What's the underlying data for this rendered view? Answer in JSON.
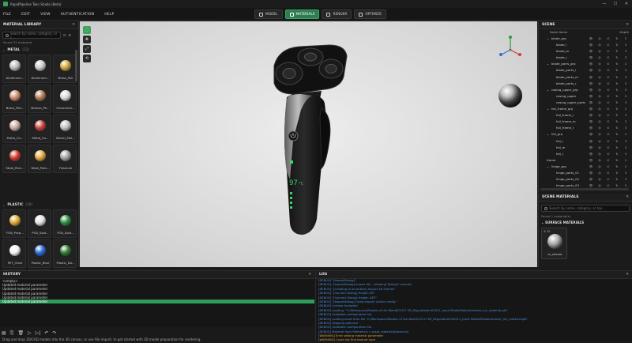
{
  "titlebar": {
    "title": "RapidPipeline Twin Studio (Beta)",
    "min": "—",
    "max": "☐",
    "close": "✕"
  },
  "menu": [
    "FILE",
    "EDIT",
    "VIEW",
    "AUTHENTICATION",
    "HELP"
  ],
  "modes": [
    {
      "label": "MODEL",
      "active": false
    },
    {
      "label": "MATERIALS",
      "active": true
    },
    {
      "label": "RENDER",
      "active": false
    },
    {
      "label": "OPTIMIZE",
      "active": false
    }
  ],
  "material_library": {
    "title": "MATERIAL LIBRARY",
    "search_placeholder": "Search by name, category, or t...",
    "found": "Found 31 materials",
    "categories": [
      {
        "name": "METAL",
        "count": "(12)"
      },
      {
        "name": "PLASTIC",
        "count": "(18)"
      }
    ],
    "metal": [
      {
        "label": "Aluminum...",
        "color": "#b9b9b9"
      },
      {
        "label": "Aluminum...",
        "color": "#c8c8c8"
      },
      {
        "label": "Brass_Poli",
        "color": "#c9a23a"
      },
      {
        "label": "Brass_Poli...",
        "color": "#c98a6a"
      },
      {
        "label": "Bronze_Pe...",
        "color": "#b07a50"
      },
      {
        "label": "Chromium...",
        "color": "#d8d8d8"
      },
      {
        "label": "Metal_Ca...",
        "color": "#c9a9a0"
      },
      {
        "label": "Metal_Ca...",
        "color": "#c8403a"
      },
      {
        "label": "Nickel_Poli...",
        "color": "#bfbfbf"
      },
      {
        "label": "Steel_Pain...",
        "color": "#d23a2a"
      },
      {
        "label": "Steel_Pain...",
        "color": "#e2a43c"
      },
      {
        "label": "Titanium",
        "color": "#a0a0a0"
      }
    ],
    "plastic": [
      {
        "label": "PCB_Prep...",
        "color": "#d8a834"
      },
      {
        "label": "PCB_Sold...",
        "color": "#e0e0e0"
      },
      {
        "label": "PCB_Sold...",
        "color": "#2a8a3a"
      },
      {
        "label": "PET_Clear",
        "color": "#f2f2f2"
      },
      {
        "label": "Plastic_Blue",
        "color": "#2a6ad8"
      },
      {
        "label": "Plastic_Da...",
        "color": "#2f7a2f"
      },
      {
        "label": "",
        "color": "#d84a3a"
      },
      {
        "label": "",
        "color": "#d88a2a"
      },
      {
        "label": "",
        "color": "#bfbfbf"
      }
    ]
  },
  "viewport_tools": [
    "⬚",
    "✥",
    "⤢",
    "⟲"
  ],
  "scene": {
    "title": "SCENE",
    "col_name": "Node Name",
    "col_depth": "Depth",
    "nodes": [
      {
        "name": "blade_grp",
        "indent": 2,
        "depth": "2",
        "chev": "⌄"
      },
      {
        "name": "blade_l",
        "indent": 3,
        "depth": "3",
        "chev": ""
      },
      {
        "name": "blade_m",
        "indent": 3,
        "depth": "3",
        "chev": ""
      },
      {
        "name": "blade_r",
        "indent": 3,
        "depth": "3",
        "chev": ""
      },
      {
        "name": "blade_parts_grp",
        "indent": 2,
        "depth": "2",
        "chev": "⌄"
      },
      {
        "name": "blade_parts_l",
        "indent": 3,
        "depth": "3",
        "chev": ""
      },
      {
        "name": "blade_parts_m",
        "indent": 3,
        "depth": "3",
        "chev": ""
      },
      {
        "name": "blade_parts_r",
        "indent": 3,
        "depth": "3",
        "chev": ""
      },
      {
        "name": "casing_upper_grp",
        "indent": 2,
        "depth": "2",
        "chev": "⌄"
      },
      {
        "name": "casing_upper",
        "indent": 3,
        "depth": "3",
        "chev": ""
      },
      {
        "name": "casing_upper_parts",
        "indent": 3,
        "depth": "3",
        "chev": ""
      },
      {
        "name": "foil_frame_grp",
        "indent": 2,
        "depth": "2",
        "chev": "⌄"
      },
      {
        "name": "foil_frame_l",
        "indent": 3,
        "depth": "3",
        "chev": ""
      },
      {
        "name": "foil_frame_m",
        "indent": 3,
        "depth": "3",
        "chev": ""
      },
      {
        "name": "foil_frame_r",
        "indent": 3,
        "depth": "3",
        "chev": ""
      },
      {
        "name": "foil_grp",
        "indent": 2,
        "depth": "2",
        "chev": "⌄"
      },
      {
        "name": "foil_l",
        "indent": 3,
        "depth": "3",
        "chev": ""
      },
      {
        "name": "foil_m",
        "indent": 3,
        "depth": "3",
        "chev": ""
      },
      {
        "name": "foil_r",
        "indent": 3,
        "depth": "3",
        "chev": ""
      },
      {
        "name": "frame",
        "indent": 1,
        "depth": "1",
        "chev": ""
      },
      {
        "name": "hinge_grp",
        "indent": 2,
        "depth": "2",
        "chev": "⌄"
      },
      {
        "name": "hinge_parts_01",
        "indent": 3,
        "depth": "3",
        "chev": ""
      },
      {
        "name": "hinge_parts_02",
        "indent": 3,
        "depth": "3",
        "chev": ""
      },
      {
        "name": "hinge_parts_03",
        "indent": 3,
        "depth": "3",
        "chev": ""
      }
    ]
  },
  "scene_materials": {
    "title": "SCENE MATERIALS",
    "search_placeholder": "Search by name, category, or tex...",
    "found": "Found 1 material(s)",
    "section": "SURFACE MATERIALS",
    "tile_label": "m_shaver",
    "tile_count": "# 35"
  },
  "shaver": {
    "display_line1": "97",
    "display_line2": "°C"
  },
  "history": {
    "title": "HISTORY",
    "items": [
      {
        "text": "<empty>",
        "selected": false
      },
      {
        "text": "Updated material parameter",
        "selected": false
      },
      {
        "text": "Updated material parameter",
        "selected": false
      },
      {
        "text": "Updated material parameter",
        "selected": false
      },
      {
        "text": "Updated material parameter",
        "selected": false
      },
      {
        "text": "Updated material parameter",
        "selected": true
      }
    ],
    "tools": [
      "▤",
      "⎘",
      "🗑",
      "▷",
      "▷|",
      "↶",
      "↷"
    ]
  },
  "log": {
    "title": "LOG",
    "lines": [
      {
        "text": "[DEBUG] \"[ImportDialog]\"",
        "warn": false
      },
      {
        "text": "[DEBUG] \"[ImportDialog] Import file - Initiating TwinJob\" activity\"",
        "warn": false
      },
      {
        "text": "[DEBUG] \"[Creating to do button] Import 3D Format\"",
        "warn": false
      },
      {
        "text": "[DEBUG] \"[Convert Dialog] Height: 85\"",
        "warn": false
      },
      {
        "text": "[DEBUG] \"[Convert Dialog] Height: 487\"",
        "warn": false
      },
      {
        "text": "[DEBUG] \"[ImportDialog] Using import: Active config.\"",
        "warn": false
      },
      {
        "text": "[DEBUG] License Accepted",
        "warn": false
      },
      {
        "text": "[DEBUG] Loading: \"C:/Workspace/Models of the World/COCO 3D_Regulated/m05011_input Model/Models/shaver_mv_material.glb\"",
        "warn": false
      },
      {
        "text": "[DEBUG] Validated configuration file.",
        "warn": false
      },
      {
        "text": "[DEBUG] Loading asset from file 'C:/Workspace/Models of the World/COCO 3D_Regulated/m05011_input Model/Models/shaver_mv_material.glb'",
        "warn": false
      },
      {
        "text": "[DEBUG] Skipping optimize",
        "warn": false
      },
      {
        "text": "[DEBUG] Validated configuration file.",
        "warn": false
      },
      {
        "text": "[DEBUG] Material from Reference: r_asset_material/shaver/v4",
        "warn": false
      },
      {
        "text": "[WARNING] Error setting material parameter",
        "warn": true
      },
      {
        "text": "[WARNING] Could not find texture type",
        "warn": true
      }
    ]
  },
  "status": "Drag and drop 3D/CAD models into the 3D canvas, or use File import, to get started with 3D model preparation for rendering."
}
